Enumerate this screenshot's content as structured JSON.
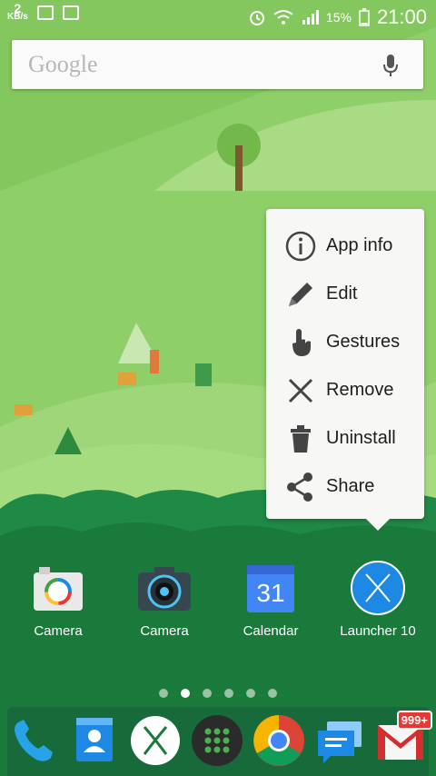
{
  "status_bar": {
    "speed_value": "2",
    "speed_unit": "KB/s",
    "battery_percent": "15%",
    "time": "21:00"
  },
  "search": {
    "logo_text": "Google",
    "icons": [
      "mic-icon"
    ]
  },
  "context_menu": {
    "items": [
      {
        "label": "App info",
        "icon": "info-icon"
      },
      {
        "label": "Edit",
        "icon": "pencil-icon"
      },
      {
        "label": "Gestures",
        "icon": "gesture-hand-icon"
      },
      {
        "label": "Remove",
        "icon": "close-icon"
      },
      {
        "label": "Uninstall",
        "icon": "trash-icon"
      },
      {
        "label": "Share",
        "icon": "share-icon"
      }
    ]
  },
  "apps": [
    {
      "label": "Camera",
      "icon": "camera-icon"
    },
    {
      "label": "Camera",
      "icon": "camera-lens-icon"
    },
    {
      "label": "Calendar",
      "icon": "calendar-icon",
      "day": "31"
    },
    {
      "label": "Launcher 10",
      "icon": "launcher-x-icon"
    }
  ],
  "page_indicator": {
    "count": 6,
    "active": 2
  },
  "dock": {
    "apps": [
      "phone-icon",
      "contacts-icon",
      "launcher-x-icon",
      "app-drawer-icon",
      "chrome-icon",
      "messages-icon",
      "gmail-icon"
    ],
    "gmail_badge": "999+"
  },
  "colors": {
    "wallpaper_light": "#8fcf6a",
    "hill_dark": "#1a7a3c",
    "dock_bg": "#176b3b",
    "launcher_blue": "#1e88e5"
  }
}
